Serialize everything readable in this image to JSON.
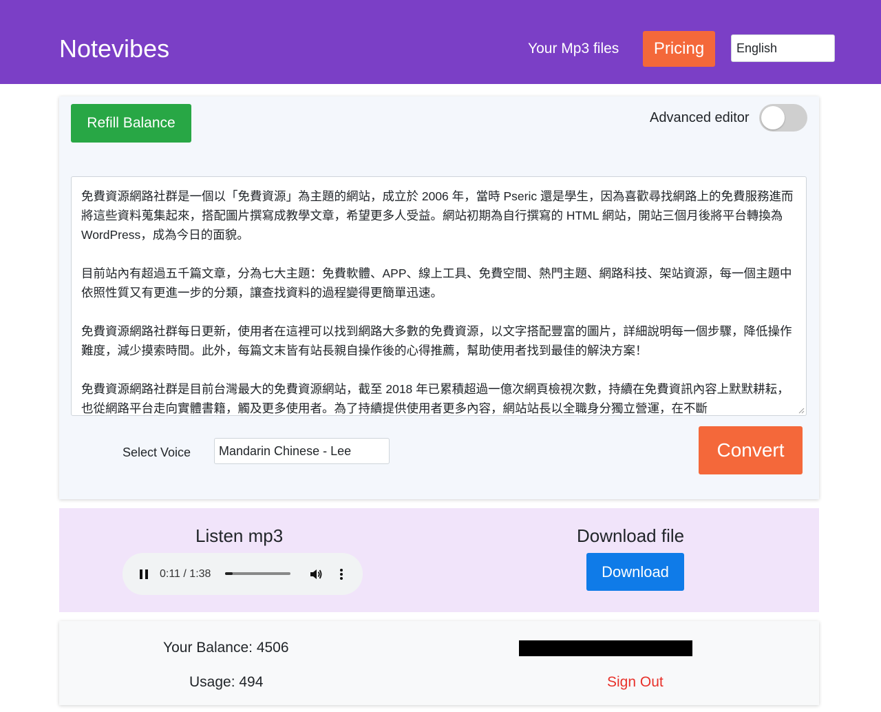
{
  "header": {
    "brand": "Notevibes",
    "nav_mp3": "Your Mp3 files",
    "nav_pricing": "Pricing",
    "language": "English"
  },
  "editor": {
    "refill_label": "Refill Balance",
    "advanced_editor_label": "Advanced editor",
    "advanced_editor_on": false,
    "paragraphs": [
      "免費資源網路社群是一個以「免費資源」為主題的網站，成立於 2006 年，當時 Pseric 還是學生，因為喜歡尋找網路上的免費服務進而將這些資料蒐集起來，搭配圖片撰寫成教學文章，希望更多人受益。網站初期為自行撰寫的 HTML 網站，開站三個月後將平台轉換為 WordPress，成為今日的面貌。",
      "目前站內有超過五千篇文章，分為七大主題：免費軟體、APP、線上工具、免費空間、熱門主題、網路科技、架站資源，每一個主題中依照性質又有更進一步的分類，讓查找資料的過程變得更簡單迅速。",
      "免費資源網路社群每日更新，使用者在這裡可以找到網路大多數的免費資源，以文字搭配豐富的圖片，詳細說明每一個步驟，降低操作難度，減少摸索時間。此外，每篇文末皆有站長親自操作後的心得推薦，幫助使用者找到最佳的解決方案！",
      "免費資源網路社群是目前台灣最大的免費資源網站，截至 2018 年已累積超過一億次網頁檢視次數，持續在免費資訊內容上默默耕耘，也從網路平台走向實體書籍，觸及更多使用者。為了持續提供使用者更多內容，網站站長以全職身分獨立營運，在不斷"
    ],
    "select_voice_label": "Select Voice",
    "voice_value": "Mandarin Chinese - Lee",
    "convert_label": "Convert"
  },
  "output": {
    "listen_title": "Listen mp3",
    "player": {
      "time": "0:11 / 1:38",
      "progress_fraction": 0.112
    },
    "download_title": "Download file",
    "download_label": "Download"
  },
  "account": {
    "balance": "Your Balance: 4506",
    "usage": "Usage: 494",
    "sign_out": "Sign Out"
  },
  "colors": {
    "header_bg": "#7b3fc6",
    "accent_orange": "#f4683a",
    "success_green": "#28a745",
    "primary_blue": "#0f7be8",
    "output_bg": "#f1e4fa",
    "signout_red": "#e8312a"
  },
  "icons": {
    "pause": "pause-icon",
    "volume": "volume-icon",
    "more": "more-vertical-icon"
  }
}
